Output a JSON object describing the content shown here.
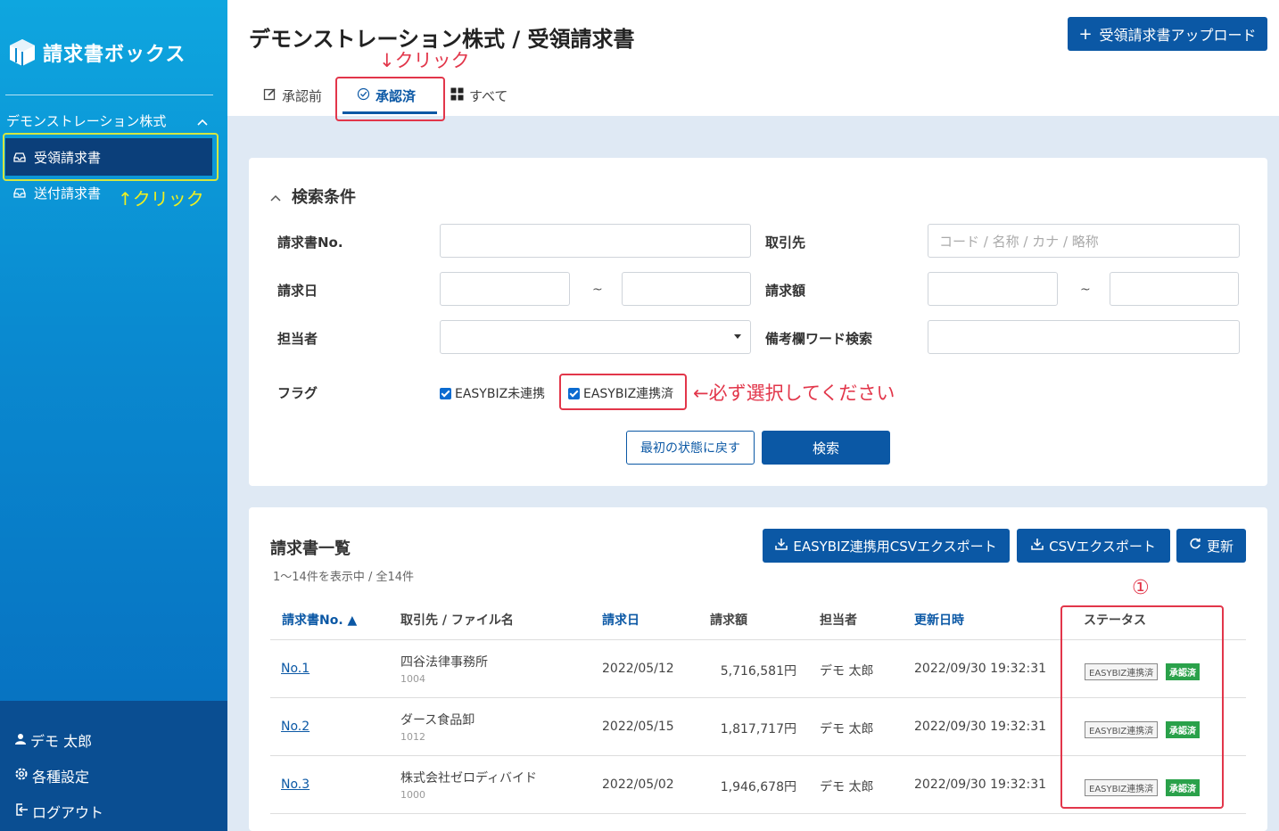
{
  "sidebar": {
    "app_name": "請求書ボックス",
    "company": "デモンストレーション株式",
    "items": [
      {
        "label": "受領請求書"
      },
      {
        "label": "送付請求書"
      }
    ],
    "user": "デモ 太郎",
    "settings": "各種設定",
    "logout": "ログアウト"
  },
  "annotations": {
    "click_up": "↑クリック",
    "click_down": "↓クリック",
    "must_select": "←必ず選択してください",
    "circle_one": "①"
  },
  "header": {
    "title": "デモンストレーション株式 / 受領請求書",
    "upload_label": "受領請求書アップロード",
    "tabs": [
      {
        "label": "承認前"
      },
      {
        "label": "承認済"
      },
      {
        "label": "すべて"
      }
    ]
  },
  "search": {
    "title": "検索条件",
    "invoice_no_label": "請求書No.",
    "partner_label": "取引先",
    "partner_placeholder": "コード / 名称 / カナ / 略称",
    "date_label": "請求日",
    "amount_label": "請求額",
    "tilde": "~",
    "person_label": "担当者",
    "memo_label": "備考欄ワード検索",
    "flag_label": "フラグ",
    "flag_unlinked": "EASYBIZ未連携",
    "flag_linked": "EASYBIZ連携済",
    "reset_label": "最初の状態に戻す",
    "search_label": "検索"
  },
  "list": {
    "title": "請求書一覧",
    "count_text": "1〜14件を表示中 / 全14件",
    "export_easybiz": "EASYBIZ連携用CSVエクスポート",
    "export_csv": "CSVエクスポート",
    "refresh": "更新",
    "columns": {
      "invoice_no": "請求書No. ▲",
      "partner": "取引先 / ファイル名",
      "date": "請求日",
      "amount": "請求額",
      "person": "担当者",
      "updated": "更新日時",
      "status": "ステータス"
    },
    "rows": [
      {
        "no": "No.1",
        "partner": "四谷法律事務所",
        "code": "1004",
        "date": "2022/05/12",
        "amount": "5,716,581円",
        "person": "デモ 太郎",
        "updated": "2022/09/30 19:32:31",
        "badge1": "EASYBIZ連携済",
        "badge2": "承認済"
      },
      {
        "no": "No.2",
        "partner": "ダース食品卸",
        "code": "1012",
        "date": "2022/05/15",
        "amount": "1,817,717円",
        "person": "デモ 太郎",
        "updated": "2022/09/30 19:32:31",
        "badge1": "EASYBIZ連携済",
        "badge2": "承認済"
      },
      {
        "no": "No.3",
        "partner": "株式会社ゼロディバイド",
        "code": "1000",
        "date": "2022/05/02",
        "amount": "1,946,678円",
        "person": "デモ 太郎",
        "updated": "2022/09/30 19:32:31",
        "badge1": "EASYBIZ連携済",
        "badge2": "承認済"
      }
    ]
  }
}
